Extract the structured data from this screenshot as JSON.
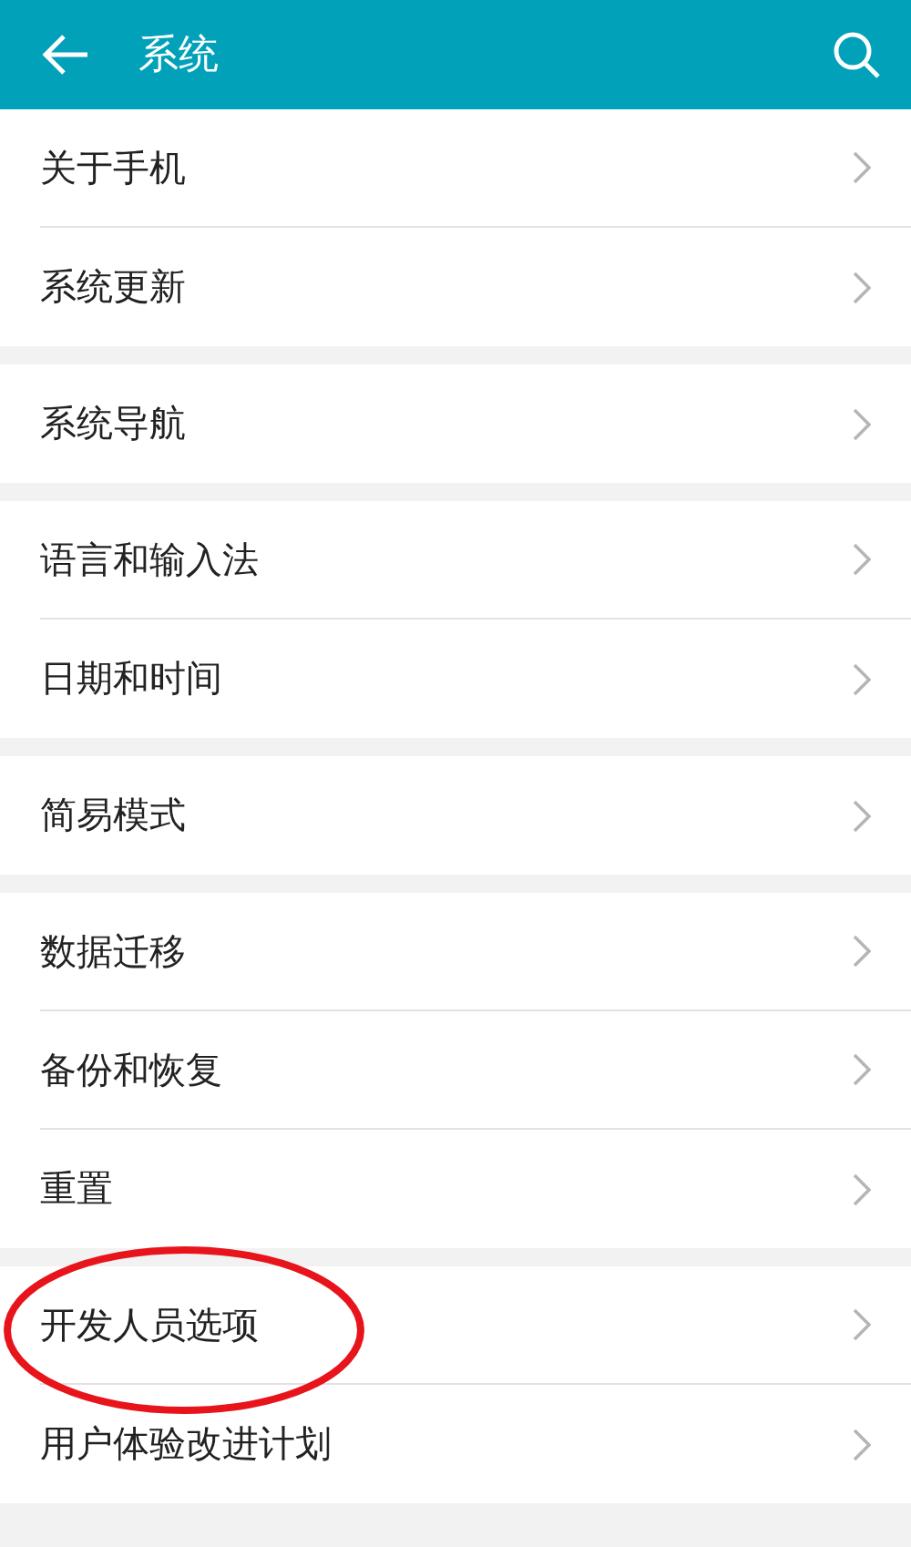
{
  "header": {
    "title": "系统"
  },
  "groups": [
    {
      "items": [
        {
          "label": "关于手机"
        },
        {
          "label": "系统更新"
        }
      ]
    },
    {
      "items": [
        {
          "label": "系统导航"
        }
      ]
    },
    {
      "items": [
        {
          "label": "语言和输入法"
        },
        {
          "label": "日期和时间"
        }
      ]
    },
    {
      "items": [
        {
          "label": "简易模式"
        }
      ]
    },
    {
      "items": [
        {
          "label": "数据迁移"
        },
        {
          "label": "备份和恢复"
        },
        {
          "label": "重置"
        }
      ]
    },
    {
      "items": [
        {
          "label": "开发人员选项"
        },
        {
          "label": "用户体验改进计划"
        }
      ]
    }
  ]
}
